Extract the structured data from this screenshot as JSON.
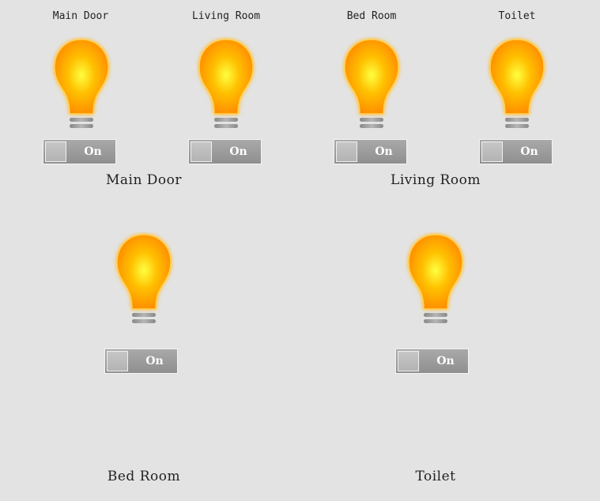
{
  "top_row": [
    {
      "label": "Main Door",
      "switch_state": "On"
    },
    {
      "label": "Living Room",
      "switch_state": "On"
    },
    {
      "label": "Bed Room",
      "switch_state": "On"
    },
    {
      "label": "Toilet",
      "switch_state": "On"
    }
  ],
  "group_labels": {
    "main_door": "Main Door",
    "living_room": "Living Room",
    "bed_room": "Bed Room",
    "toilet": "Toilet"
  },
  "bottom_row": [
    {
      "switch_state": "On"
    },
    {
      "switch_state": "On"
    }
  ],
  "colors": {
    "background": "#e3e3e3",
    "bulb_center": "#ffff33",
    "bulb_edge": "#ff8800",
    "switch": "#999999"
  },
  "icons": {
    "bulb": "light-bulb-icon"
  }
}
